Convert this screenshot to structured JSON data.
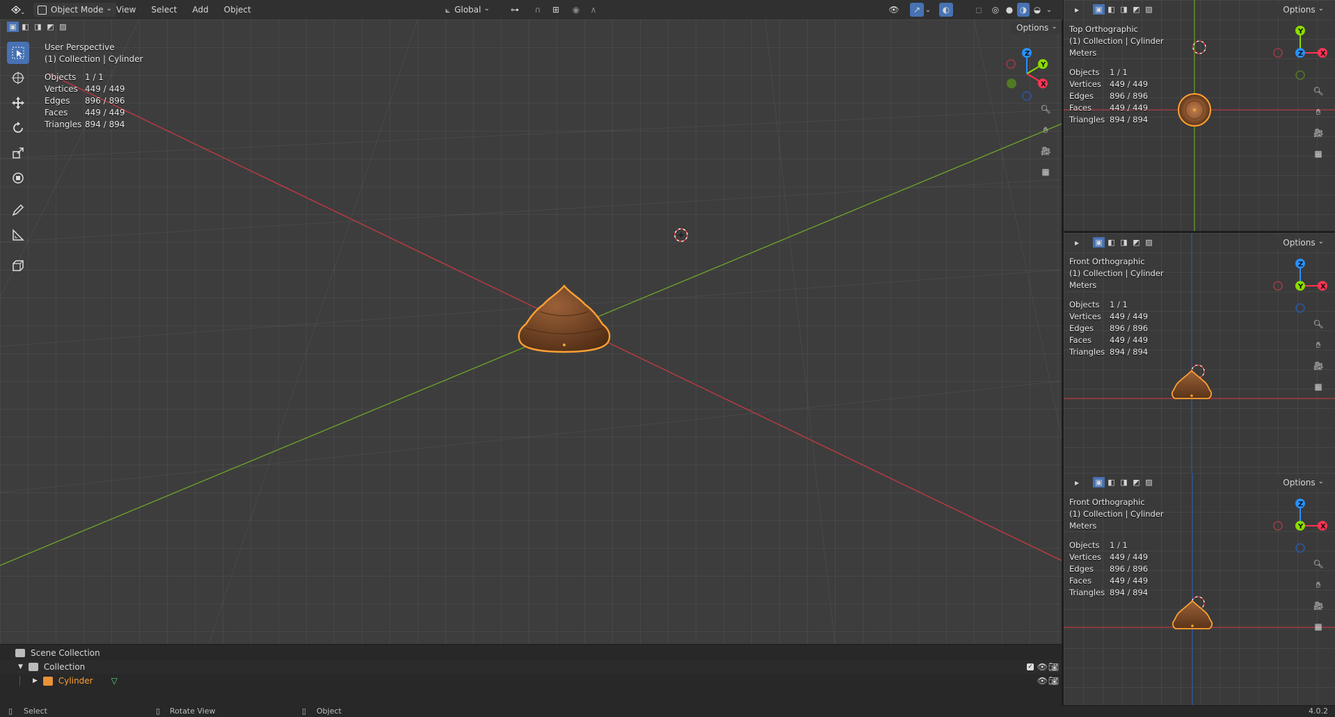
{
  "header": {
    "mode": "Object Mode",
    "menus": [
      "View",
      "Select",
      "Add",
      "Object"
    ],
    "transform_orientation": "Global",
    "options_label": "Options"
  },
  "viewport": {
    "title": "User Perspective",
    "collection": "(1) Collection | Cylinder",
    "stats": [
      {
        "label": "Objects",
        "value": "1 / 1"
      },
      {
        "label": "Vertices",
        "value": "449 / 449"
      },
      {
        "label": "Edges",
        "value": "896 / 896"
      },
      {
        "label": "Faces",
        "value": "449 / 449"
      },
      {
        "label": "Triangles",
        "value": "894 / 894"
      }
    ],
    "gizmo_axes": {
      "x": "X",
      "y": "Y",
      "z": "Z"
    }
  },
  "side_views": [
    {
      "title": "Top Orthographic",
      "collection": "(1) Collection | Cylinder",
      "units": "Meters",
      "options": "Options",
      "stats": [
        {
          "label": "Objects",
          "value": "1 / 1"
        },
        {
          "label": "Vertices",
          "value": "449 / 449"
        },
        {
          "label": "Edges",
          "value": "896 / 896"
        },
        {
          "label": "Faces",
          "value": "449 / 449"
        },
        {
          "label": "Triangles",
          "value": "894 / 894"
        }
      ],
      "gizmo_axes": {
        "a": "Y",
        "b": "Z",
        "c": "X"
      }
    },
    {
      "title": "Front Orthographic",
      "collection": "(1) Collection | Cylinder",
      "units": "Meters",
      "options": "Options",
      "stats": [
        {
          "label": "Objects",
          "value": "1 / 1"
        },
        {
          "label": "Vertices",
          "value": "449 / 449"
        },
        {
          "label": "Edges",
          "value": "896 / 896"
        },
        {
          "label": "Faces",
          "value": "449 / 449"
        },
        {
          "label": "Triangles",
          "value": "894 / 894"
        }
      ],
      "gizmo_axes": {
        "a": "Z",
        "b": "Y",
        "c": "X"
      }
    },
    {
      "title": "Front Orthographic",
      "collection": "(1) Collection | Cylinder",
      "units": "Meters",
      "options": "Options",
      "stats": [
        {
          "label": "Objects",
          "value": "1 / 1"
        },
        {
          "label": "Vertices",
          "value": "449 / 449"
        },
        {
          "label": "Edges",
          "value": "896 / 896"
        },
        {
          "label": "Faces",
          "value": "449 / 449"
        },
        {
          "label": "Triangles",
          "value": "894 / 894"
        }
      ],
      "gizmo_axes": {
        "a": "Z",
        "b": "Y",
        "c": "X"
      }
    }
  ],
  "outliner": {
    "scene_collection": "Scene Collection",
    "collection": "Collection",
    "object": "Cylinder"
  },
  "statusbar": {
    "select": "Select",
    "rotate": "Rotate View",
    "object": "Object",
    "version": "4.0.2"
  },
  "colors": {
    "axis_x": "#ff3352",
    "axis_y": "#8bdc00",
    "axis_z": "#2890ff",
    "selection": "#ffa033",
    "object_brown": "#7a4a2a"
  }
}
